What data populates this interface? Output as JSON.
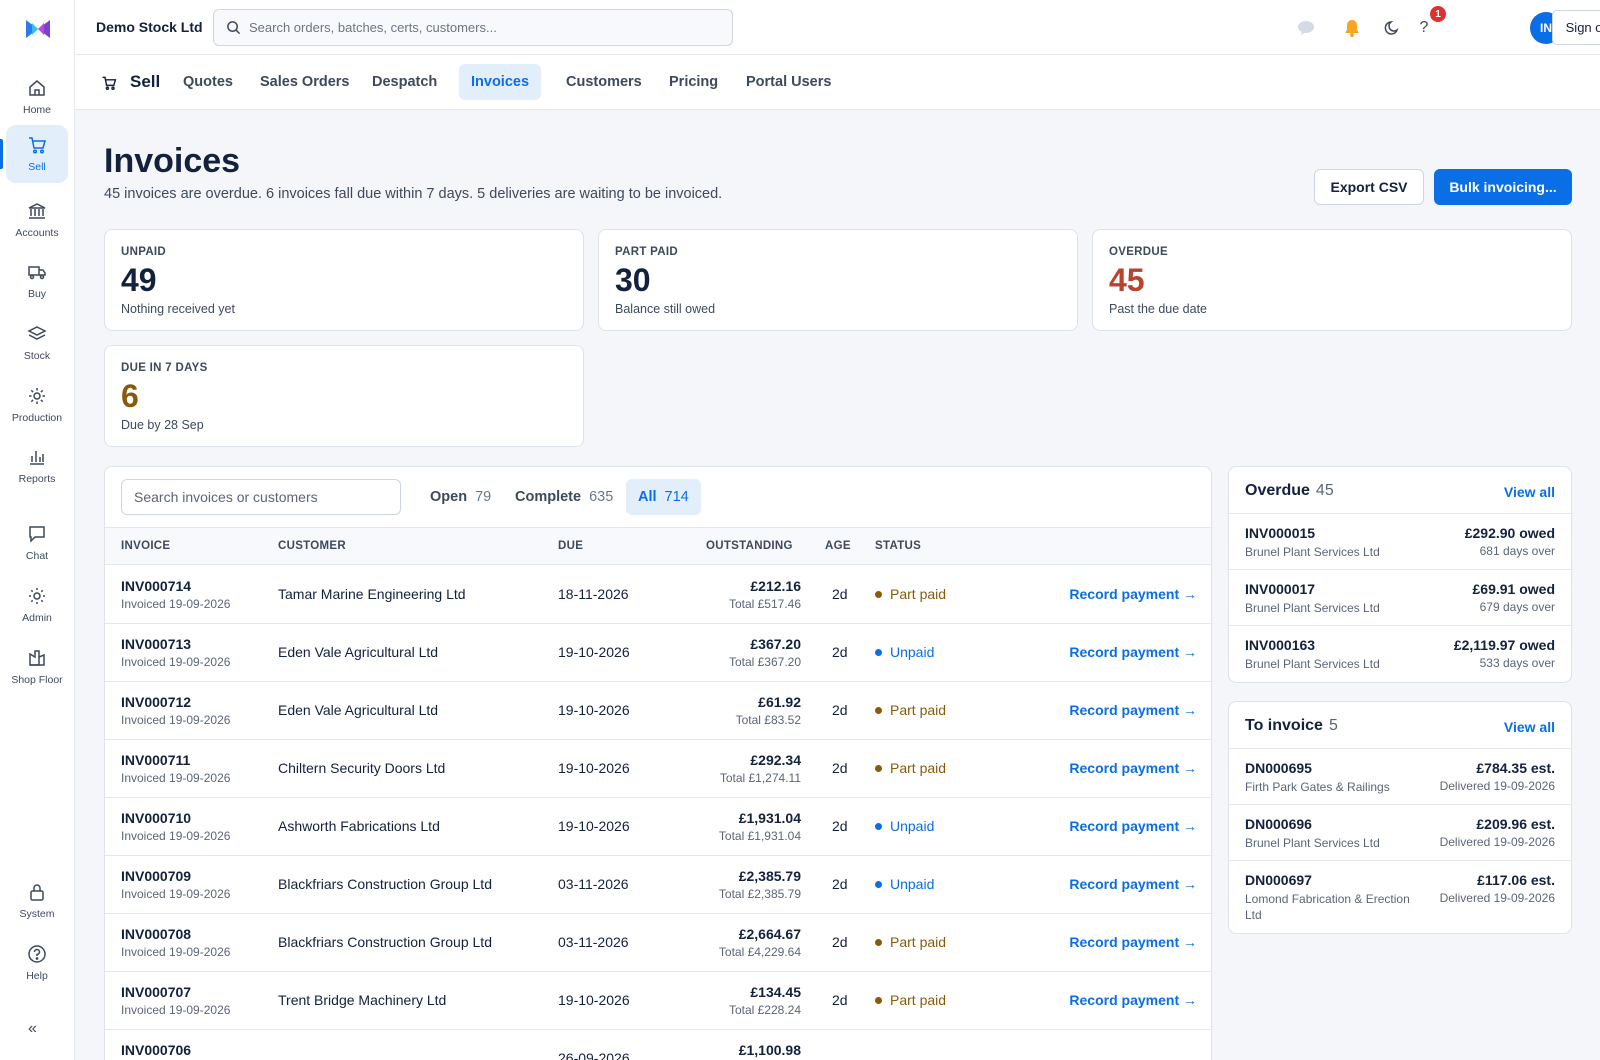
{
  "header": {
    "company": "Demo Stock Ltd",
    "search_placeholder": "Search orders, batches, certs, customers...",
    "notification_count": "1",
    "avatar_initials": "IN",
    "signout_label": "Sign out"
  },
  "sidebar": {
    "items": [
      {
        "label": "Home",
        "icon": "home-icon"
      },
      {
        "label": "Sell",
        "icon": "cart-icon",
        "active": true
      },
      {
        "label": "Accounts",
        "icon": "bank-icon"
      },
      {
        "label": "Buy",
        "icon": "truck-icon"
      },
      {
        "label": "Stock",
        "icon": "layers-icon"
      },
      {
        "label": "Production",
        "icon": "gear-icon"
      },
      {
        "label": "Reports",
        "icon": "bar-chart-icon"
      },
      {
        "label": "Chat",
        "icon": "chat-icon"
      },
      {
        "label": "Admin",
        "icon": "sun-icon"
      },
      {
        "label": "Shop Floor",
        "icon": "factory-icon"
      },
      {
        "label": "System",
        "icon": "lock-icon"
      },
      {
        "label": "Help",
        "icon": "help-icon"
      }
    ],
    "collapse_glyph": "«"
  },
  "subnav": {
    "section": "Sell",
    "tabs": [
      {
        "label": "Quotes"
      },
      {
        "label": "Sales Orders"
      },
      {
        "label": "Despatch"
      },
      {
        "label": "Invoices",
        "active": true
      },
      {
        "label": "Customers"
      },
      {
        "label": "Pricing"
      },
      {
        "label": "Portal Users"
      }
    ]
  },
  "page": {
    "title": "Invoices",
    "subtitle": "45 invoices are overdue. 6 invoices fall due within 7 days. 5 deliveries are waiting to be invoiced.",
    "export_label": "Export CSV",
    "bulk_label": "Bulk invoicing..."
  },
  "stats": [
    {
      "label": "UNPAID",
      "value": "49",
      "desc": "Nothing received yet",
      "color": "#14213d"
    },
    {
      "label": "PART PAID",
      "value": "30",
      "desc": "Balance still owed",
      "color": "#14213d"
    },
    {
      "label": "OVERDUE",
      "value": "45",
      "desc": "Past the due date",
      "color": "#b8432e"
    },
    {
      "label": "DUE IN 7 DAYS",
      "value": "6",
      "desc": "Due by 28 Sep",
      "color": "#8a5a0b"
    }
  ],
  "table": {
    "search_placeholder": "Search invoices or customers",
    "filters": [
      {
        "label": "Open",
        "count": "79"
      },
      {
        "label": "Complete",
        "count": "635"
      },
      {
        "label": "All",
        "count": "714",
        "active": true
      }
    ],
    "columns": [
      "INVOICE",
      "CUSTOMER",
      "DUE",
      "OUTSTANDING",
      "AGE",
      "STATUS"
    ],
    "status_colors": {
      "Part paid": "#8a5a0b",
      "Unpaid": "#0a6ee6"
    },
    "rows": [
      {
        "invoice": "INV000714",
        "invoiced": "Invoiced 19-09-2026",
        "customer": "Tamar Marine Engineering Ltd",
        "due": "18-11-2026",
        "outstanding": "£212.16",
        "total": "Total £517.46",
        "age": "2d",
        "status": "Part paid",
        "action": "Record payment →"
      },
      {
        "invoice": "INV000713",
        "invoiced": "Invoiced 19-09-2026",
        "customer": "Eden Vale Agricultural Ltd",
        "due": "19-10-2026",
        "outstanding": "£367.20",
        "total": "Total £367.20",
        "age": "2d",
        "status": "Unpaid",
        "action": "Record payment →"
      },
      {
        "invoice": "INV000712",
        "invoiced": "Invoiced 19-09-2026",
        "customer": "Eden Vale Agricultural Ltd",
        "due": "19-10-2026",
        "outstanding": "£61.92",
        "total": "Total £83.52",
        "age": "2d",
        "status": "Part paid",
        "action": "Record payment →"
      },
      {
        "invoice": "INV000711",
        "invoiced": "Invoiced 19-09-2026",
        "customer": "Chiltern Security Doors Ltd",
        "due": "19-10-2026",
        "outstanding": "£292.34",
        "total": "Total £1,274.11",
        "age": "2d",
        "status": "Part paid",
        "action": "Record payment →"
      },
      {
        "invoice": "INV000710",
        "invoiced": "Invoiced 19-09-2026",
        "customer": "Ashworth Fabrications Ltd",
        "due": "19-10-2026",
        "outstanding": "£1,931.04",
        "total": "Total £1,931.04",
        "age": "2d",
        "status": "Unpaid",
        "action": "Record payment →"
      },
      {
        "invoice": "INV000709",
        "invoiced": "Invoiced 19-09-2026",
        "customer": "Blackfriars Construction Group Ltd",
        "due": "03-11-2026",
        "outstanding": "£2,385.79",
        "total": "Total £2,385.79",
        "age": "2d",
        "status": "Unpaid",
        "action": "Record payment →"
      },
      {
        "invoice": "INV000708",
        "invoiced": "Invoiced 19-09-2026",
        "customer": "Blackfriars Construction Group Ltd",
        "due": "03-11-2026",
        "outstanding": "£2,664.67",
        "total": "Total £4,229.64",
        "age": "2d",
        "status": "Part paid",
        "action": "Record payment →"
      },
      {
        "invoice": "INV000707",
        "invoiced": "Invoiced 19-09-2026",
        "customer": "Trent Bridge Machinery Ltd",
        "due": "19-10-2026",
        "outstanding": "£134.45",
        "total": "Total £228.24",
        "age": "2d",
        "status": "Part paid",
        "action": "Record payment →"
      },
      {
        "invoice": "INV000706",
        "invoiced": "",
        "customer": "",
        "due": "26-09-2026",
        "outstanding": "£1,100.98",
        "total": "",
        "age": "",
        "status": "",
        "action": ""
      }
    ]
  },
  "overdue_panel": {
    "title": "Overdue",
    "count": "45",
    "link": "View all",
    "items": [
      {
        "id": "INV000015",
        "customer": "Brunel Plant Services Ltd",
        "amount": "£292.90 owed",
        "sub": "681 days over"
      },
      {
        "id": "INV000017",
        "customer": "Brunel Plant Services Ltd",
        "amount": "£69.91 owed",
        "sub": "679 days over"
      },
      {
        "id": "INV000163",
        "customer": "Brunel Plant Services Ltd",
        "amount": "£2,119.97 owed",
        "sub": "533 days over"
      }
    ]
  },
  "to_invoice_panel": {
    "title": "To invoice",
    "count": "5",
    "link": "View all",
    "items": [
      {
        "id": "DN000695",
        "customer": "Firth Park Gates & Railings",
        "amount": "£784.35 est.",
        "sub": "Delivered 19-09-2026"
      },
      {
        "id": "DN000696",
        "customer": "Brunel Plant Services Ltd",
        "amount": "£209.96 est.",
        "sub": "Delivered 19-09-2026"
      },
      {
        "id": "DN000697",
        "customer": "Lomond Fabrication & Erection Ltd",
        "amount": "£117.06 est.",
        "sub": "Delivered 19-09-2026"
      }
    ]
  }
}
